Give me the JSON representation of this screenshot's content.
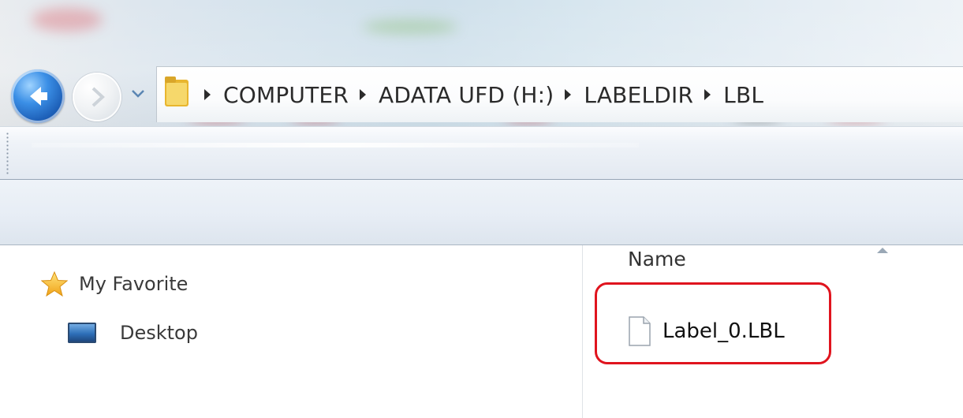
{
  "address_bar": {
    "breadcrumbs": [
      "COMPUTER",
      "ADATA UFD (H:)",
      "LABELDIR",
      "LBL"
    ]
  },
  "navigation": {
    "back_icon": "back-arrow-icon",
    "forward_icon": "forward-arrow-icon",
    "recent_pages_icon": "chevron-down-icon"
  },
  "sidebar": {
    "items": [
      {
        "label": "My Favorite",
        "icon": "star-icon"
      },
      {
        "label": "Desktop",
        "icon": "desktop-icon"
      }
    ]
  },
  "file_list": {
    "column_header": "Name",
    "sort_icon": "sort-ascending-icon",
    "items": [
      {
        "name": "Label_0.LBL",
        "icon": "file-icon"
      }
    ]
  },
  "colors": {
    "highlight": "#e0141e",
    "back_button": "#2a79d8",
    "folder": "#f2c84b"
  }
}
